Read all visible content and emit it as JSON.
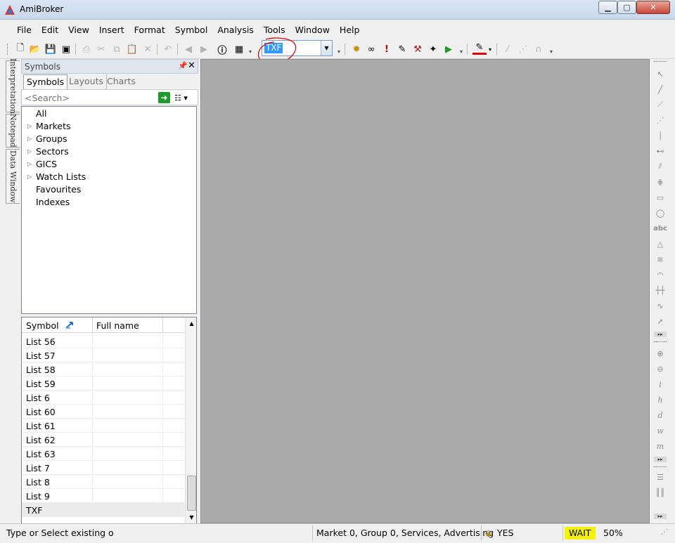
{
  "window": {
    "title": "AmiBroker"
  },
  "menu": [
    "File",
    "Edit",
    "View",
    "Insert",
    "Format",
    "Symbol",
    "Analysis",
    "Tools",
    "Window",
    "Help"
  ],
  "toolbar": {
    "symbol_value": "TXF"
  },
  "side_tabs": [
    "Interpretation",
    "Notepad",
    "Data Window"
  ],
  "symbols_panel": {
    "title": "Symbols",
    "tabs": [
      "Symbols",
      "Layouts",
      "Charts"
    ],
    "search_placeholder": "<Search>",
    "tree": [
      {
        "label": "All",
        "expandable": false
      },
      {
        "label": "Markets",
        "expandable": true
      },
      {
        "label": "Groups",
        "expandable": true
      },
      {
        "label": "Sectors",
        "expandable": true
      },
      {
        "label": "GICS",
        "expandable": true
      },
      {
        "label": "Watch Lists",
        "expandable": true
      },
      {
        "label": "Favourites",
        "expandable": false
      },
      {
        "label": "Indexes",
        "expandable": false
      }
    ],
    "table": {
      "columns": [
        "Symbol",
        "Full name"
      ],
      "rows": [
        "List 56",
        "List 57",
        "List 58",
        "List 59",
        "List 6",
        "List 60",
        "List 61",
        "List 62",
        "List 63",
        "List 7",
        "List 8",
        "List 9",
        "TXF"
      ],
      "selected": "TXF"
    }
  },
  "status": {
    "hint": "Type or Select existing o",
    "market": "Market 0, Group 0, Services, Advertising",
    "yes": "YES",
    "wait": "WAIT",
    "percent": "50%"
  },
  "colors": {
    "accent": "#3399ff",
    "mdi_background": "#ababab",
    "wait_highlight": "#f6f400",
    "annotation": "#e00000"
  }
}
